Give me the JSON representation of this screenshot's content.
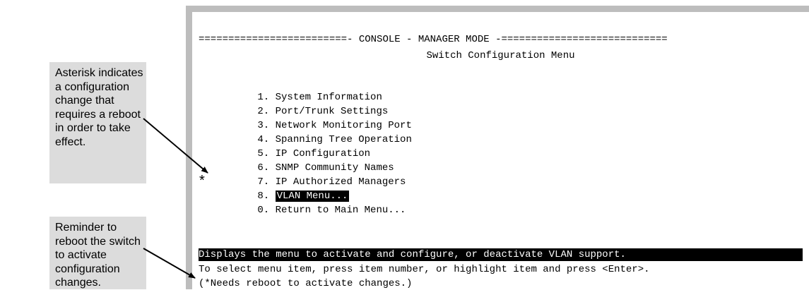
{
  "callouts": {
    "asterisk": [
      "Asterisk indicates",
      "a configuration",
      "change that",
      "requires a reboot",
      "in order to take",
      "effect."
    ],
    "reboot": [
      "Reminder to",
      "reboot the switch",
      "to activate",
      "configuration",
      "changes."
    ]
  },
  "console": {
    "header_bar": "=========================- CONSOLE - MANAGER MODE -============================",
    "title": "Switch Configuration Menu",
    "menu_items": [
      {
        "num": "1.",
        "label": "System Information"
      },
      {
        "num": "2.",
        "label": "Port/Trunk Settings"
      },
      {
        "num": "3.",
        "label": "Network Monitoring Port"
      },
      {
        "num": "4.",
        "label": "Spanning Tree Operation"
      },
      {
        "num": "5.",
        "label": "IP Configuration"
      },
      {
        "num": "6.",
        "label": "SNMP Community Names"
      },
      {
        "num": "7.",
        "label": "IP Authorized Managers"
      },
      {
        "num": "8.",
        "label": "VLAN Menu...",
        "marker": "*"
      },
      {
        "num": "0.",
        "label": "Return to Main Menu..."
      }
    ],
    "status_line": "Displays the menu to activate and configure, or deactivate VLAN support.",
    "instruction_line": "To select menu item, press item number, or highlight item and press <Enter>.",
    "note_line": "(*Needs reboot to activate changes.)"
  },
  "colors": {
    "callout_bg": "#dcdcdc",
    "frame": "#bdbdbd",
    "highlight": "#000000"
  }
}
